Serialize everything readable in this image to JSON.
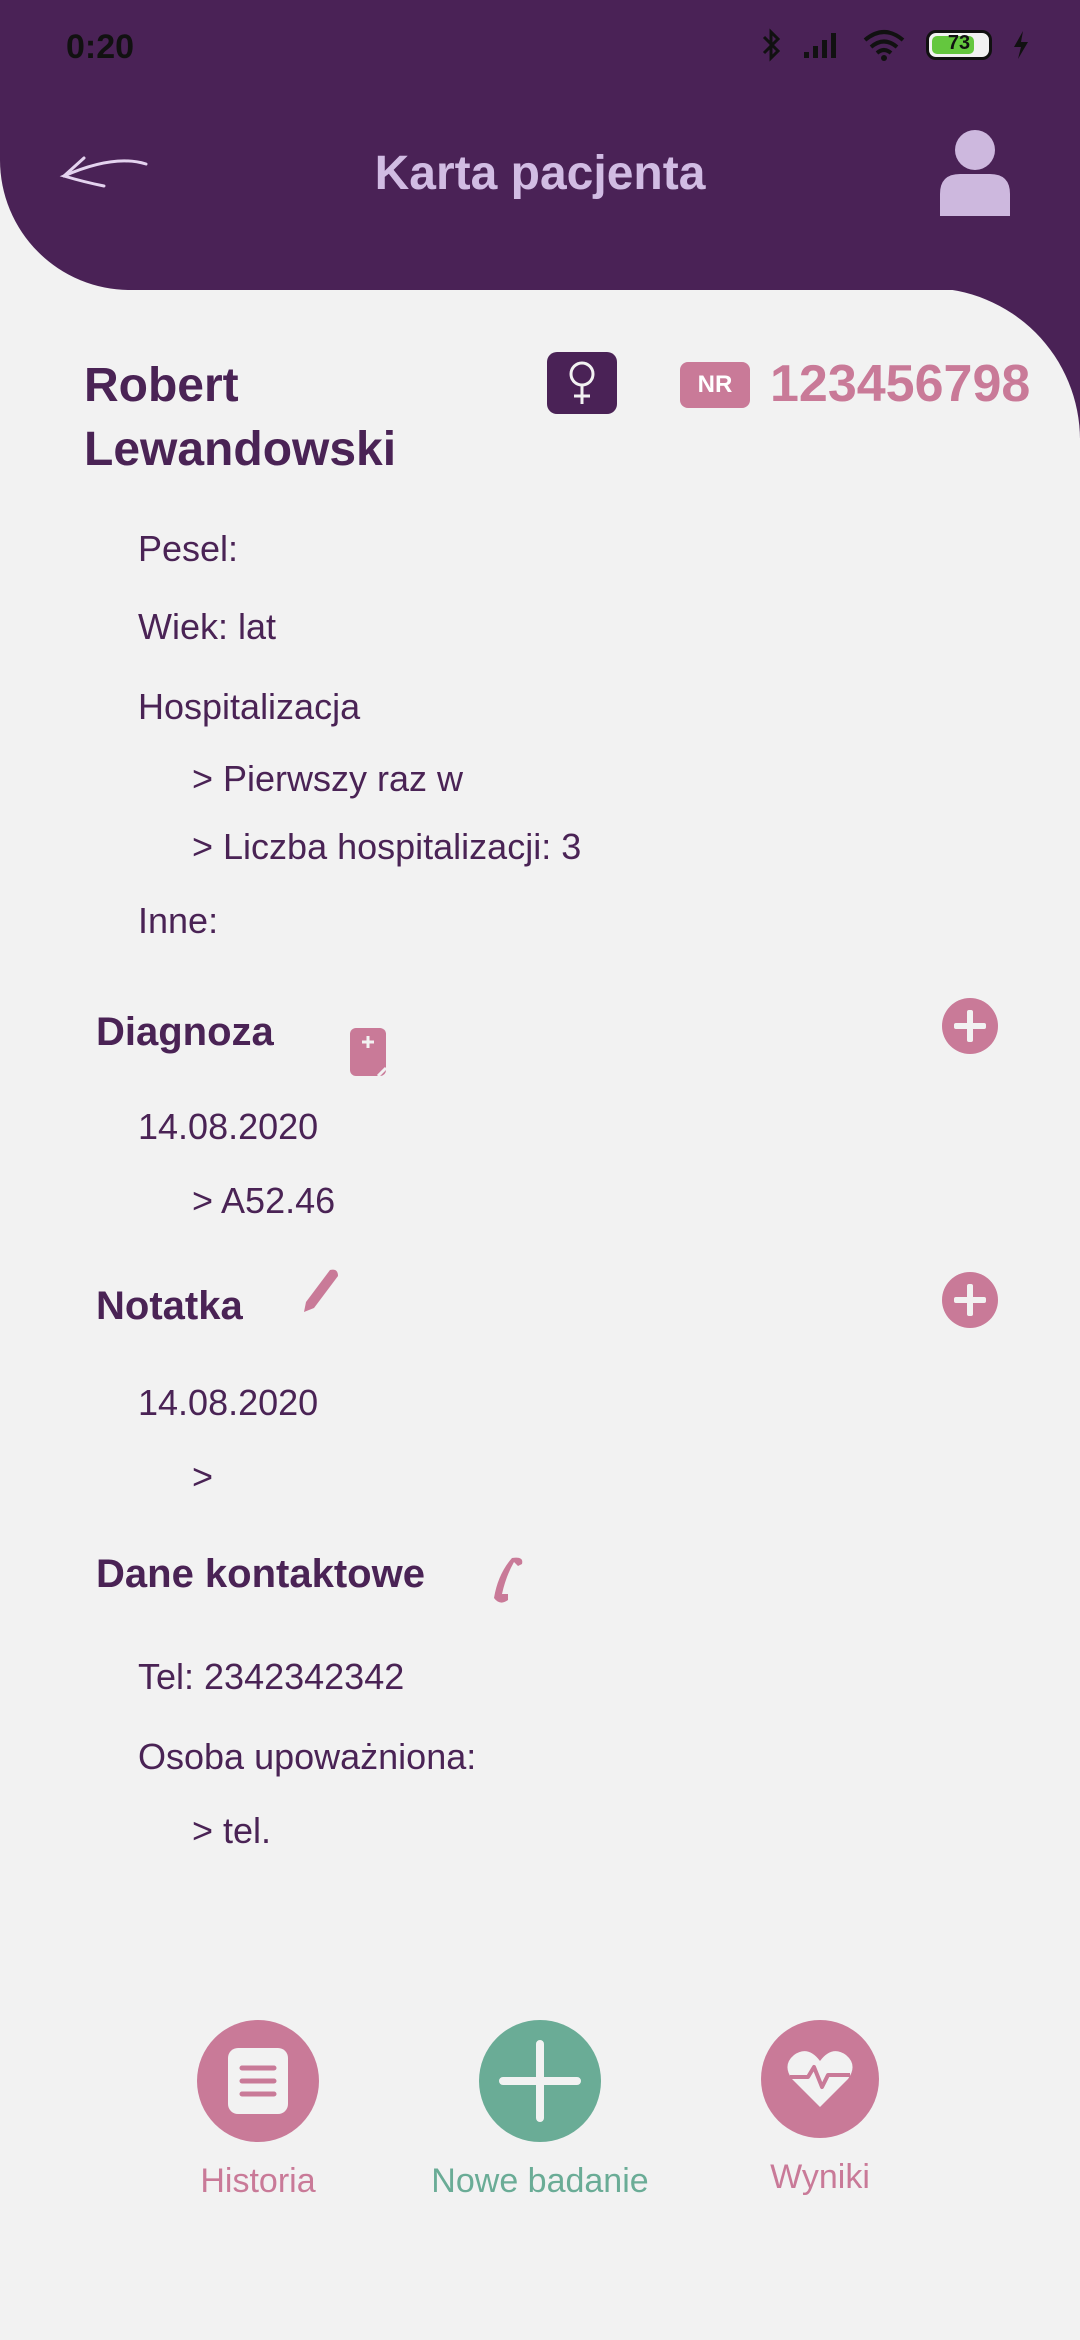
{
  "status": {
    "time": "0:20",
    "battery": "73"
  },
  "header": {
    "title": "Karta pacjenta"
  },
  "patient": {
    "name": "Robert Lewandowski",
    "nr_label": "NR",
    "nr_value": "123456798",
    "pesel": "Pesel:",
    "wiek": "Wiek:  lat",
    "hospitalizacja": "Hospitalizacja",
    "hosp_first": "> Pierwszy raz w",
    "hosp_count": "> Liczba hospitalizacji: 3",
    "inne": "Inne:"
  },
  "diagnoza": {
    "title": "Diagnoza",
    "date": "14.08.2020",
    "code": "> A52.46"
  },
  "notatka": {
    "title": "Notatka",
    "date": "14.08.2020",
    "text": ">"
  },
  "kontakt": {
    "title": "Dane kontaktowe",
    "tel": "Tel: 2342342342",
    "osoba": "Osoba upoważniona:",
    "osoba_tel": ">  tel."
  },
  "nav": {
    "historia": "Historia",
    "nowe": "Nowe badanie",
    "wyniki": "Wyniki"
  },
  "colors": {
    "header": "#4a2256",
    "accent_pink": "#c97a98",
    "accent_green": "#6aac96",
    "title_lilac": "#d1bce3"
  }
}
